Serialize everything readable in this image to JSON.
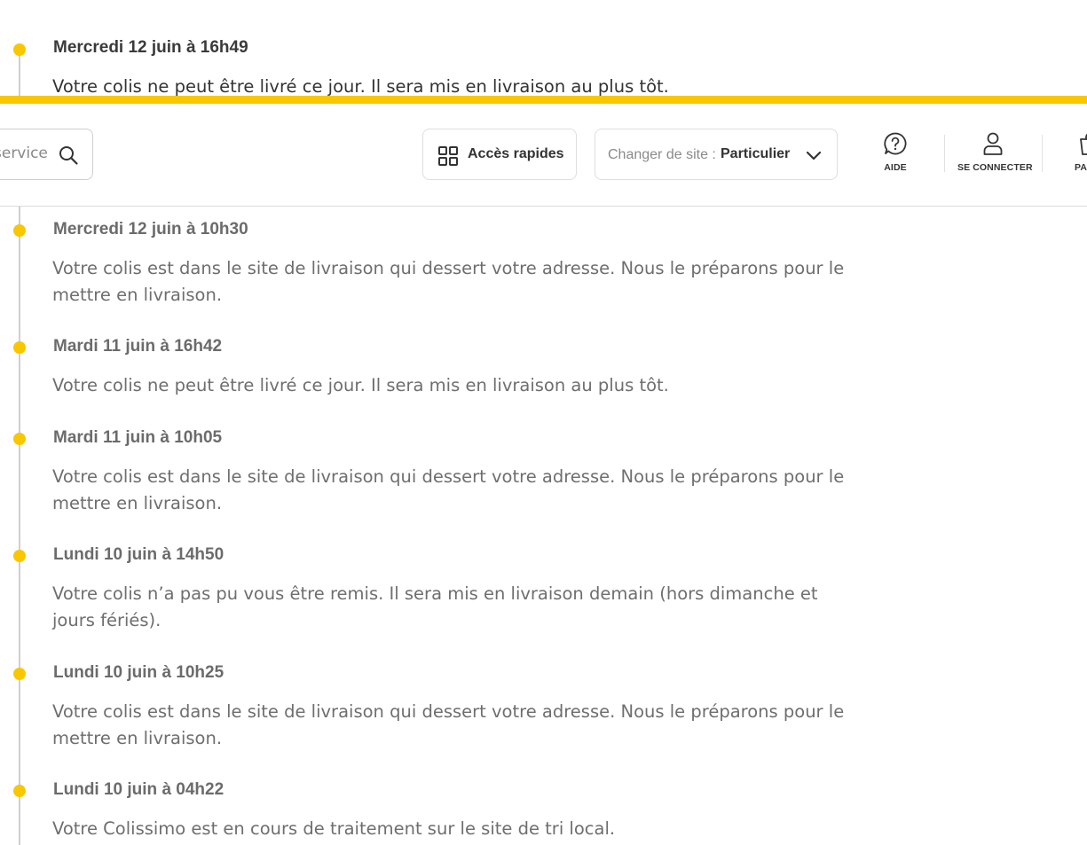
{
  "header": {
    "search_placeholder": "service ...",
    "quick_access_label": "Accès rapides",
    "site_switch_prefix": "Changer de site :",
    "site_switch_value": "Particulier",
    "help_label": "AIDE",
    "login_label": "SE CONNECTER",
    "cart_label": "PANIER",
    "accent_color": "#f9c700"
  },
  "timeline": {
    "events": [
      {
        "date": "Mercredi 12 juin à 16h49",
        "message": "Votre colis ne peut être livré ce jour. Il sera mis en livraison au plus tôt."
      },
      {
        "date": "Mercredi 12 juin à 10h30",
        "message": "Votre colis est dans le site de livraison qui dessert votre adresse. Nous le préparons pour le mettre en livraison."
      },
      {
        "date": "Mardi 11 juin à 16h42",
        "message": "Votre colis ne peut être livré ce jour. Il sera mis en livraison au plus tôt."
      },
      {
        "date": "Mardi 11 juin à 10h05",
        "message": "Votre colis est dans le site de livraison qui dessert votre adresse. Nous le préparons pour le mettre en livraison."
      },
      {
        "date": "Lundi 10 juin à 14h50",
        "message": "Votre colis n’a pas pu vous être remis. Il sera mis en livraison demain (hors dimanche et jours fériés)."
      },
      {
        "date": "Lundi 10 juin à 10h25",
        "message": "Votre colis est dans le site de livraison qui dessert votre adresse. Nous le préparons pour le mettre en livraison."
      },
      {
        "date": "Lundi 10 juin à 04h22",
        "message": "Votre Colissimo est en cours de traitement sur le site de tri local."
      }
    ]
  }
}
